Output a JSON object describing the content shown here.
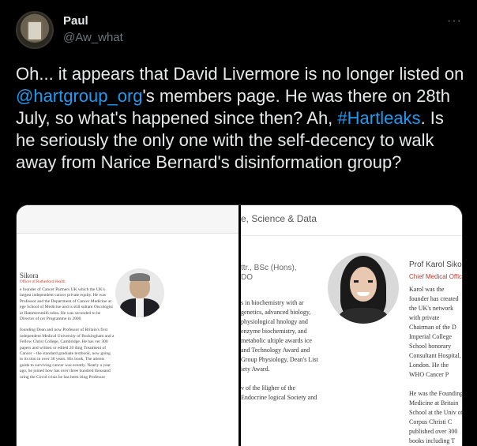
{
  "author": {
    "name": "Paul",
    "handle": "@Aw_what",
    "avatar_icon": "avatar-picture-icon"
  },
  "more_label": "···",
  "tweet": {
    "text_1": "Oh... it appears that David Livermore is no longer listed on ",
    "mention": "@hartgroup_org",
    "text_2": "'s members page. He was there on 28th July, so what's happened since then? Ah, ",
    "hashtag": "#Hartleaks",
    "text_3": ". Is he seriously the only one with the self-decency to walk away from Narice Bernard's disinformation group?"
  },
  "media_left": {
    "name": "Sikora",
    "role": "Officer of Rutherford Health",
    "paragraphs": [
      "e founder of Cancer Partners UK which the UK's largest independent cancer private equity. He was Professor and the Department of Cancer Medicine at ege School of Medicine and is still sultant Oncologist at Hammersmith ndon. He was seconded to be Director of cer Programme in 2000",
      "founding Dean and now Professor of Britain's first independent Medical University of Buckingham and a Fellow Christ College, Cambridge. He has ver 300 papers and written or edited 20 ding Treatment of Cancer – the standard graduate textbook, now going to its tion in over 30 years. His book, The atients guide to surviving cancer was ecently. Nearly a year ago, he joined how has over three hundred thousand uring the Covid crisis he has been iting Professor"
    ]
  },
  "media_right": {
    "header": "e, Science & Data",
    "frag_lines": [
      "ttr., BSc (Hons),",
      "DO"
    ],
    "col1": [
      "s in biochemistry with ar genetics, advanced biology, physiological hnology and enzyme biochemistry, and metabolic ultiple awards ice and Technology Award and Group Physiology, Dean's List iety Award.",
      "v of the Higher of the Endocrine logical Society and"
    ],
    "name": "Prof Karol Sikora",
    "role": "Chief Medical Officer",
    "col2": [
      "Karol was the founder has created the UK's network with private Chairman of the D Imperial College School honorary Consultant Hospital, London. He the WHO Cancer P",
      "He was the Founding Medicine at Britain School at the Univ of Corpus Christi C published over 300 books including T British postgradu"
    ]
  }
}
